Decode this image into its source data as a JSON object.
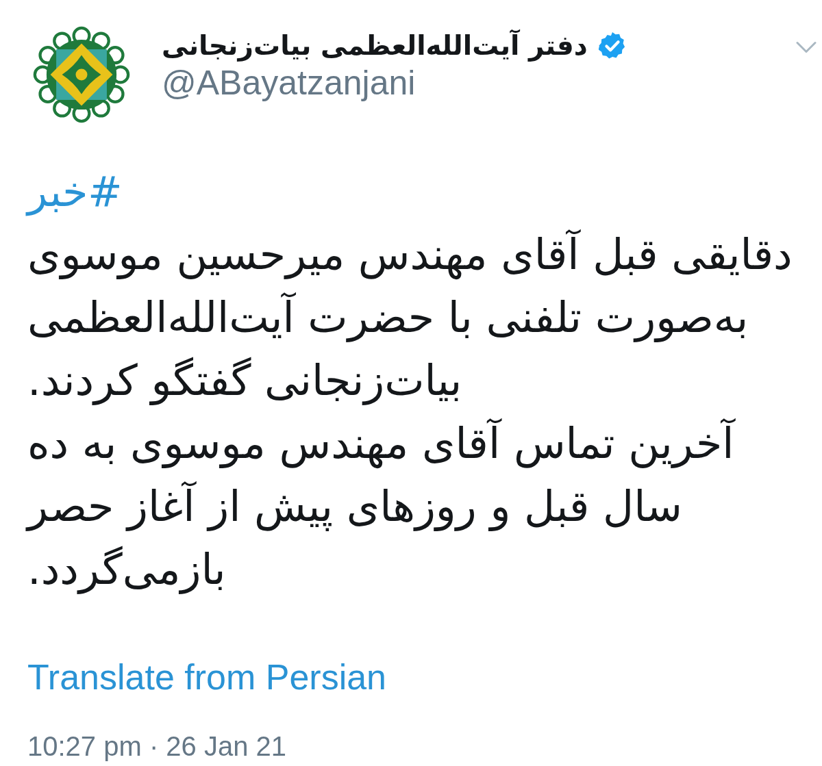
{
  "header": {
    "display_name": "دفتر آیت‌الله‌العظمی بیات‌زنجانی",
    "verified": true,
    "handle": "@ABayatzanjani"
  },
  "tweet": {
    "hashtag": "#خبر",
    "paragraphs": [
      "دقایقی قبل آقای مهندس میرحسین موسوی به‌صورت تلفنی با حضرت آیت‌الله‌العظمی بیات‌زنجانی گفتگو کردند.",
      "آخرین تماس آقای مهندس موسوی به ده سال قبل و روزهای پیش از آغاز حصر بازمی‌گردد."
    ]
  },
  "translate_link": "Translate from Persian",
  "timestamp": "10:27 pm · 26 Jan 21"
}
